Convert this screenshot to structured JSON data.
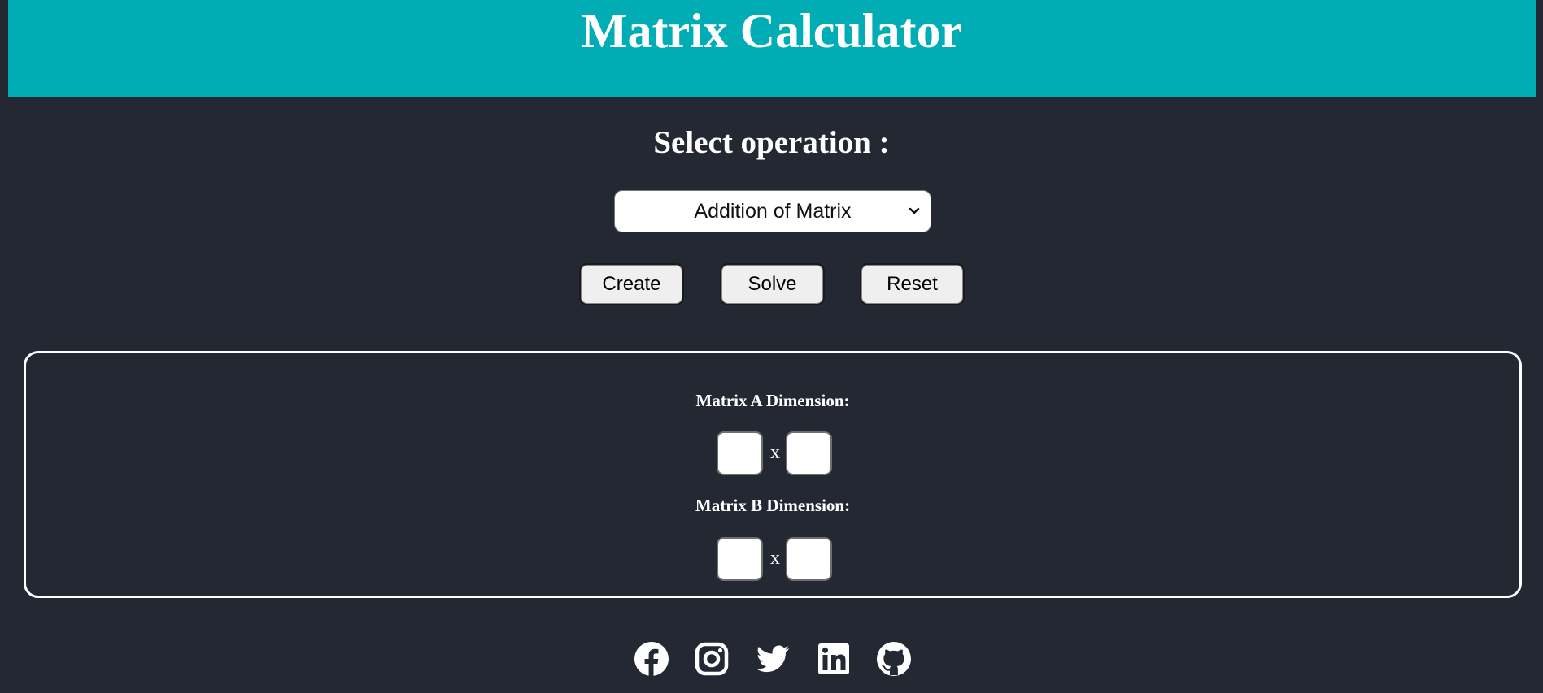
{
  "header": {
    "title": "Matrix Calculator",
    "background_color": "#00adb5"
  },
  "operation": {
    "heading": "Select operation :",
    "selected": "Addition of Matrix"
  },
  "buttons": {
    "create": "Create",
    "solve": "Solve",
    "reset": "Reset"
  },
  "dimensions": {
    "matrix_a_label": "Matrix A Dimension:",
    "matrix_b_label": "Matrix B Dimension:",
    "separator": "x",
    "matrix_a_rows": "",
    "matrix_a_cols": "",
    "matrix_b_rows": "",
    "matrix_b_cols": ""
  },
  "social": [
    {
      "icon": "facebook-icon"
    },
    {
      "icon": "instagram-icon"
    },
    {
      "icon": "twitter-icon"
    },
    {
      "icon": "linkedin-icon"
    },
    {
      "icon": "github-icon"
    }
  ],
  "colors": {
    "page_background": "#232833",
    "accent": "#00adb5"
  }
}
